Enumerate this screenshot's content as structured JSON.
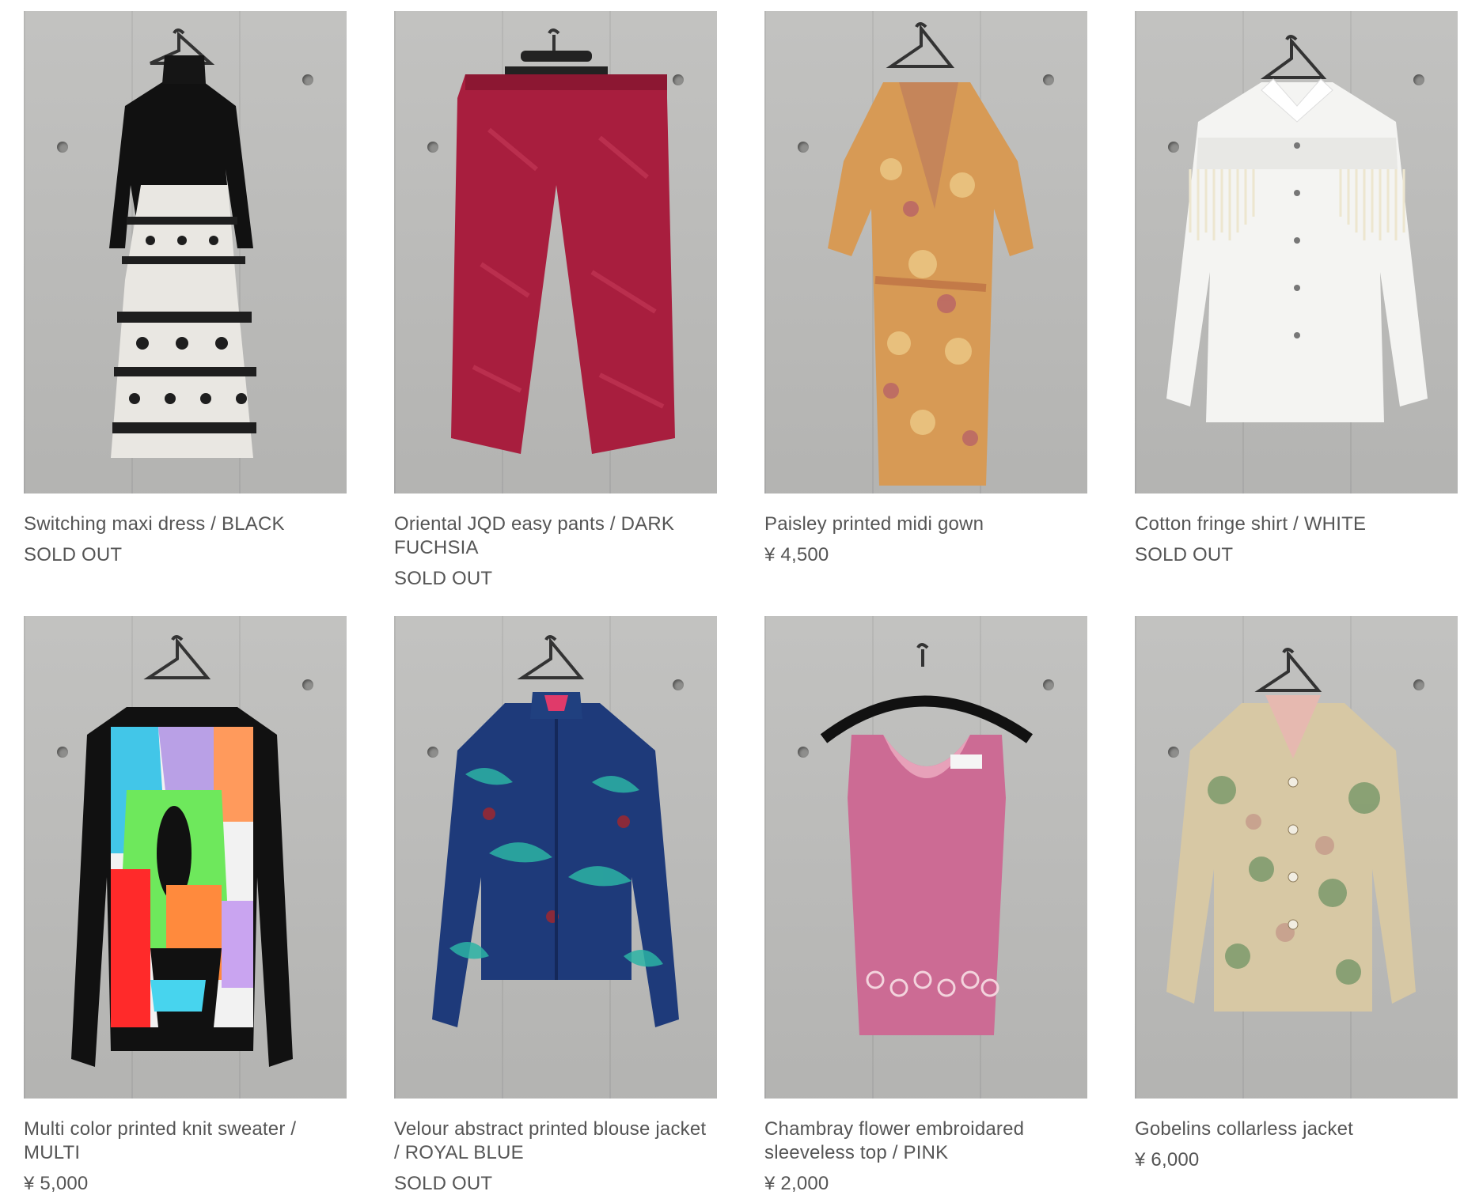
{
  "products": [
    {
      "title": "Switching maxi dress / BLACK",
      "price": "SOLD OUT",
      "image_icon": "black-maxi-dress-photo"
    },
    {
      "title": "Oriental JQD easy pants / DARK FUCHSIA",
      "price": "SOLD OUT",
      "image_icon": "fuchsia-pants-photo"
    },
    {
      "title": "Paisley printed midi gown",
      "price": "¥ 4,500",
      "image_icon": "paisley-gown-photo"
    },
    {
      "title": "Cotton fringe shirt / WHITE",
      "price": "SOLD OUT",
      "image_icon": "white-fringe-shirt-photo"
    },
    {
      "title": "Multi color printed knit sweater / MULTI",
      "price": "¥ 5,000",
      "image_icon": "multicolor-sweater-photo"
    },
    {
      "title": "Velour abstract printed blouse jacket / ROYAL BLUE",
      "price": "SOLD OUT",
      "image_icon": "royal-blue-jacket-photo"
    },
    {
      "title": "Chambray flower embroidared sleeveless top / PINK",
      "price": "¥ 2,000",
      "image_icon": "pink-sleeveless-top-photo"
    },
    {
      "title": "Gobelins collarless jacket",
      "price": "¥ 6,000",
      "image_icon": "gobelins-jacket-photo"
    }
  ],
  "colors": {
    "text": "#555555",
    "wall": "#bdbdbb",
    "background": "#ffffff"
  }
}
